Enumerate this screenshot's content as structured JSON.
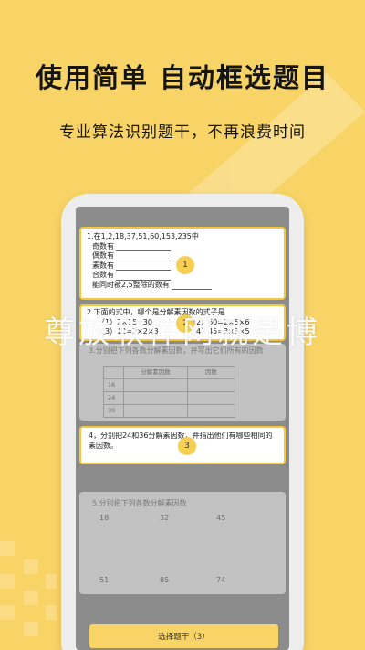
{
  "promo": {
    "headline": "使用简单 自动框选题目",
    "subline": "专业算法识别题干，不再浪费时间"
  },
  "questions": {
    "q1": {
      "title": "1.在1,2,18,37,51,60,153,235中",
      "lines": [
        "奇数有",
        "偶数有",
        "素数有",
        "合数有",
        "能同时被2,5整除的数有"
      ],
      "badge": "1"
    },
    "q2": {
      "title": "2.下面的式中，哪个是分解素因数的式子是",
      "row1_left": "（1）2×15=30",
      "row1_right": "（2）60=2×5×6",
      "row2_left": "（3）12=2×2×3",
      "row2_right": "（4）45=3×3×5",
      "badge": "2"
    },
    "q3": {
      "title": "3.分别把下列各数分解素因数，并写出它们所有的因数",
      "col_factor": "分解素因数",
      "col_divisors": "因数",
      "rows": [
        "16",
        "24",
        "30"
      ]
    },
    "q4": {
      "title": "4，分别把24和36分解素因数，并指出他们有哪些相同的素因数。",
      "badge": "3"
    },
    "q5": {
      "title": "5.分别把下列各数分解素因数",
      "nums": [
        "18",
        "32",
        "45",
        "51",
        "85",
        "74"
      ]
    }
  },
  "select_button": "选择题干（3）",
  "watermark": "尊放软件网就是博",
  "colors": {
    "background": "#F8D467",
    "accent": "#F6C739",
    "screen": "#8C8C8C"
  }
}
